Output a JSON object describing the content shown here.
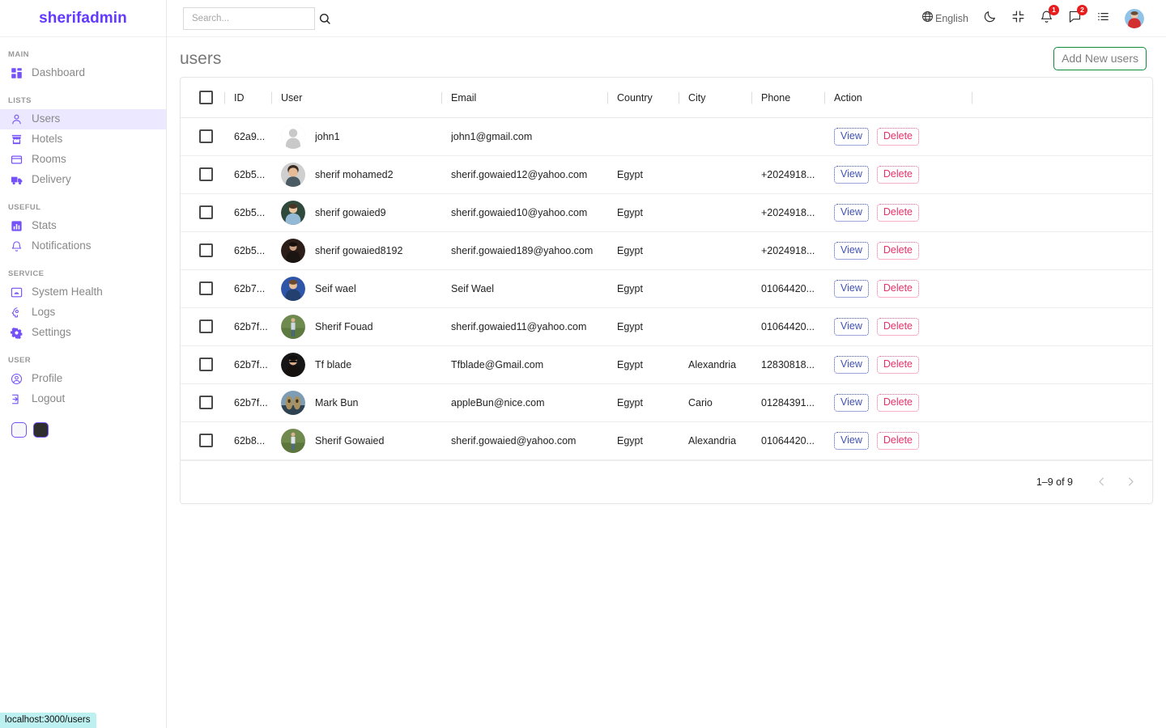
{
  "sidebar": {
    "brand": "sherifadmin",
    "sections": [
      {
        "title": "MAIN",
        "items": [
          {
            "label": "Dashboard",
            "icon": "dashboard-icon",
            "active": false
          }
        ]
      },
      {
        "title": "LISTS",
        "items": [
          {
            "label": "Users",
            "icon": "person-icon",
            "active": true
          },
          {
            "label": "Hotels",
            "icon": "store-icon",
            "active": false
          },
          {
            "label": "Rooms",
            "icon": "credit-card-icon",
            "active": false
          },
          {
            "label": "Delivery",
            "icon": "truck-icon",
            "active": false
          }
        ]
      },
      {
        "title": "USEFUL",
        "items": [
          {
            "label": "Stats",
            "icon": "bar-chart-icon",
            "active": false
          },
          {
            "label": "Notifications",
            "icon": "bell-icon",
            "active": false
          }
        ]
      },
      {
        "title": "SERVICE",
        "items": [
          {
            "label": "System Health",
            "icon": "monitor-icon",
            "active": false
          },
          {
            "label": "Logs",
            "icon": "psychology-icon",
            "active": false
          },
          {
            "label": "Settings",
            "icon": "settings-icon",
            "active": false
          }
        ]
      },
      {
        "title": "USER",
        "items": [
          {
            "label": "Profile",
            "icon": "account-circle-icon",
            "active": false
          },
          {
            "label": "Logout",
            "icon": "exit-icon",
            "active": false
          }
        ]
      }
    ],
    "theme_toggles": [
      {
        "name": "light-theme-swatch"
      },
      {
        "name": "dark-theme-swatch"
      }
    ]
  },
  "navbar": {
    "search_placeholder": "Search...",
    "search_value": "",
    "language": "English",
    "notifications_count": "1",
    "messages_count": "2"
  },
  "page": {
    "title": "users",
    "add_button": "Add New users"
  },
  "table": {
    "columns": [
      "ID",
      "User",
      "Email",
      "Country",
      "City",
      "Phone",
      "Action"
    ],
    "rows": [
      {
        "id": "62a9...",
        "user": "john1",
        "email": "john1@gmail.com",
        "country": "",
        "city": "",
        "phone": "",
        "view": "View",
        "delete": "Delete",
        "avatar": "placeholder"
      },
      {
        "id": "62b5...",
        "user": "sherif mohamed2",
        "email": "sherif.gowaied12@yahoo.com",
        "country": "Egypt",
        "city": "",
        "phone": "+2024918...",
        "view": "View",
        "delete": "Delete",
        "avatar": "a1"
      },
      {
        "id": "62b5...",
        "user": "sherif gowaied9",
        "email": "sherif.gowaied10@yahoo.com",
        "country": "Egypt",
        "city": "",
        "phone": "+2024918...",
        "view": "View",
        "delete": "Delete",
        "avatar": "a2"
      },
      {
        "id": "62b5...",
        "user": "sherif gowaied8192",
        "email": "sherif.gowaied189@yahoo.com",
        "country": "Egypt",
        "city": "",
        "phone": "+2024918...",
        "view": "View",
        "delete": "Delete",
        "avatar": "a3"
      },
      {
        "id": "62b7...",
        "user": "Seif wael",
        "email": "Seif Wael",
        "country": "Egypt",
        "city": "",
        "phone": "01064420...",
        "view": "View",
        "delete": "Delete",
        "avatar": "a4"
      },
      {
        "id": "62b7f...",
        "user": "Sherif Fouad",
        "email": "sherif.gowaied11@yahoo.com",
        "country": "Egypt",
        "city": "",
        "phone": "01064420...",
        "view": "View",
        "delete": "Delete",
        "avatar": "a5"
      },
      {
        "id": "62b7f...",
        "user": "Tf blade",
        "email": "Tfblade@Gmail.com",
        "country": "Egypt",
        "city": "Alexandria",
        "phone": "12830818...",
        "view": "View",
        "delete": "Delete",
        "avatar": "a6"
      },
      {
        "id": "62b7f...",
        "user": "Mark Bun",
        "email": "appleBun@nice.com",
        "country": "Egypt",
        "city": "Cario",
        "phone": "01284391...",
        "view": "View",
        "delete": "Delete",
        "avatar": "a7"
      },
      {
        "id": "62b8...",
        "user": "Sherif Gowaied",
        "email": "sherif.gowaied@yahoo.com",
        "country": "Egypt",
        "city": "Alexandria",
        "phone": "01064420...",
        "view": "View",
        "delete": "Delete",
        "avatar": "a8"
      }
    ],
    "pagination_label": "1–9 of 9"
  },
  "statusbar": {
    "url": "localhost:3000/users"
  },
  "colors": {
    "brand": "#6439ff",
    "accent": "#7451f8",
    "active_bg": "#ece8ff",
    "add_button_border": "#128c3a",
    "view_border": "#3f51b5",
    "delete_text": "#e53268",
    "badge": "#e81c1c",
    "status_bg": "#bdf0f0"
  }
}
